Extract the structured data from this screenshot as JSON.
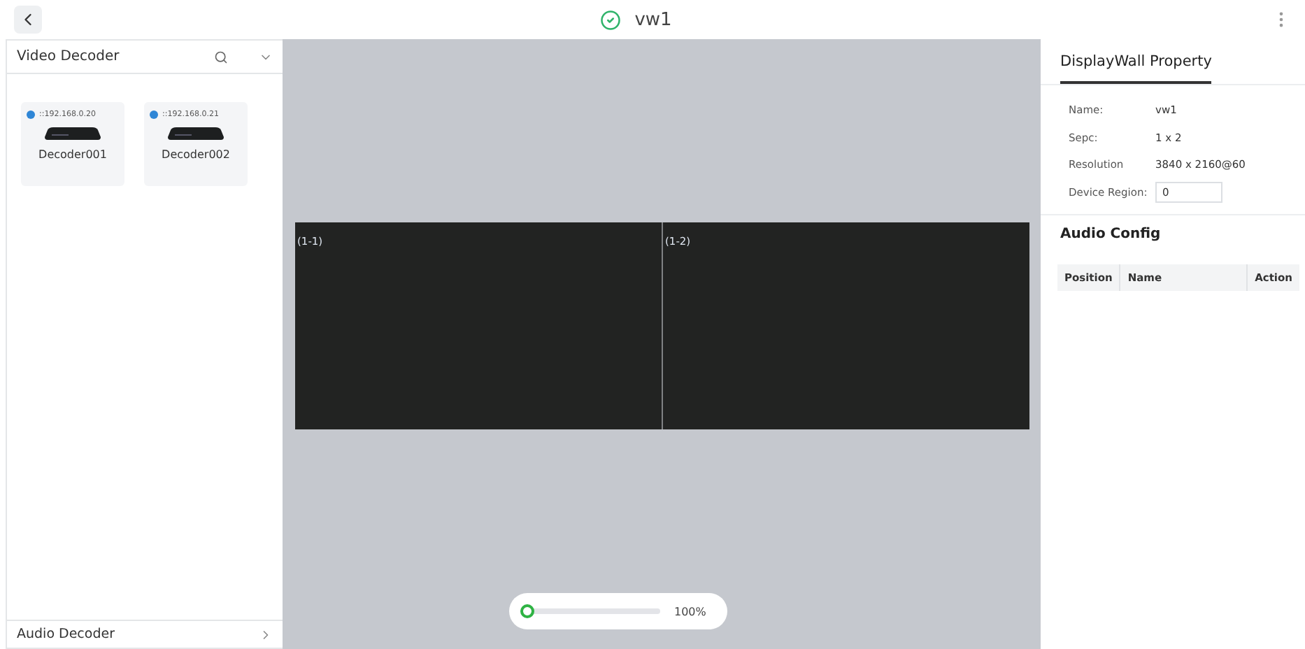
{
  "header": {
    "title": "vw1"
  },
  "left_panel": {
    "title": "Video Decoder",
    "decoders": [
      {
        "address": "::192.168.0.20",
        "name": "Decoder001",
        "color": "#2f86d6"
      },
      {
        "address": "::192.168.0.21",
        "name": "Decoder002",
        "color": "#2f86d6"
      }
    ],
    "footer": "Audio Decoder"
  },
  "wall": {
    "screens": [
      "(1-1)",
      "(1-2)"
    ],
    "zoom": {
      "level": 0,
      "reading": "100%"
    }
  },
  "property": {
    "tab": "DisplayWall Property",
    "fields": [
      {
        "label": "Name:",
        "value": "vw1",
        "kind": "text"
      },
      {
        "label": "Sepc:",
        "value": "1 x 2",
        "kind": "text"
      },
      {
        "label": "Resolution",
        "value": "3840 x 2160@60",
        "kind": "text"
      },
      {
        "label": "Device Region:",
        "value": "0",
        "kind": "input"
      }
    ]
  },
  "audio_config": {
    "title": "Audio Config",
    "columns": [
      "Position",
      "Name",
      "Action"
    ]
  }
}
